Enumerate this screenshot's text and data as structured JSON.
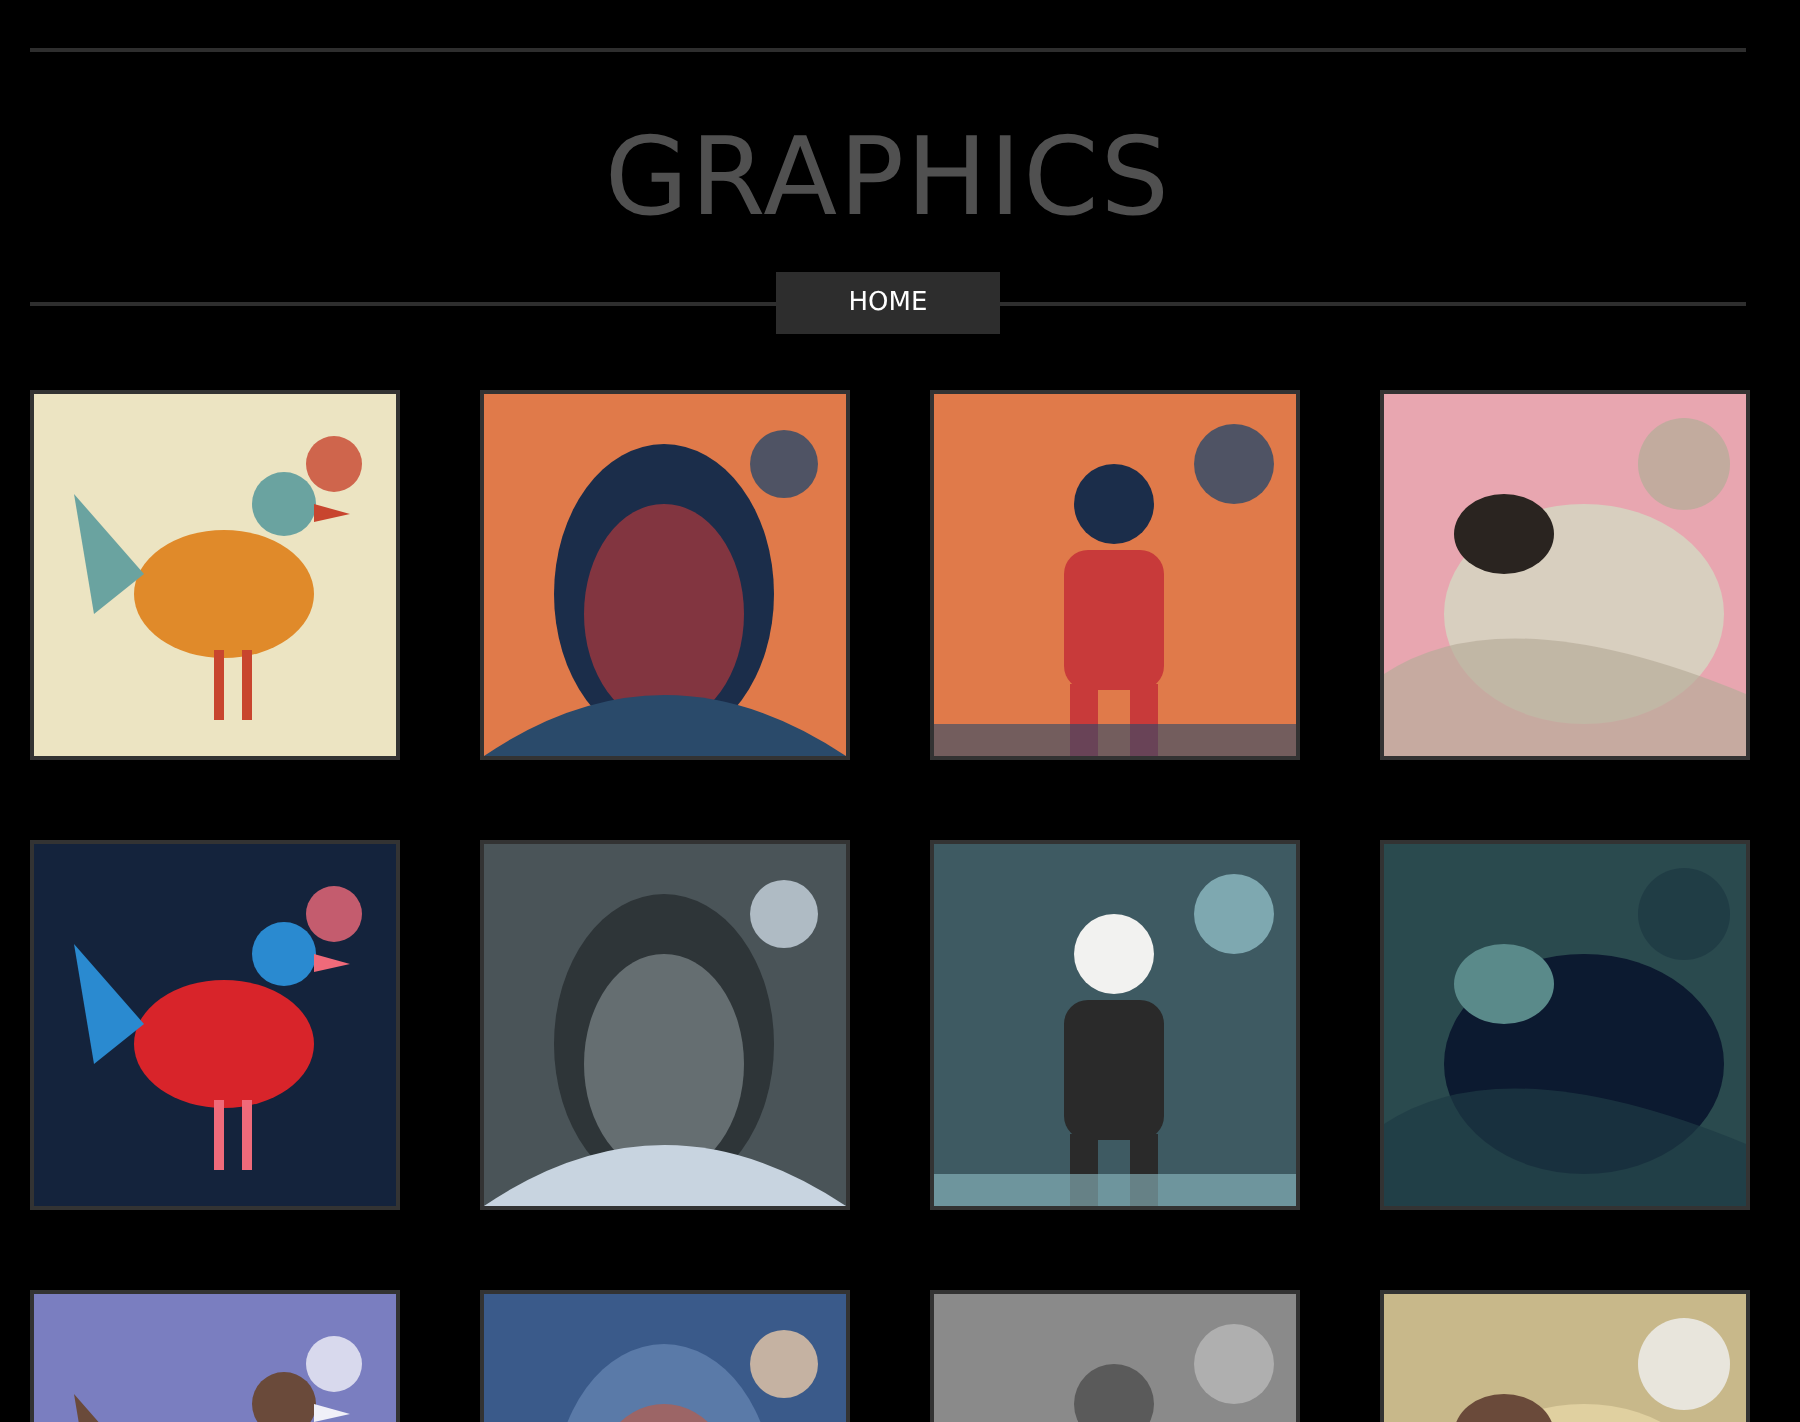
{
  "title": "GRAPHICS",
  "nav": [
    {
      "label": "HOME"
    }
  ]
}
